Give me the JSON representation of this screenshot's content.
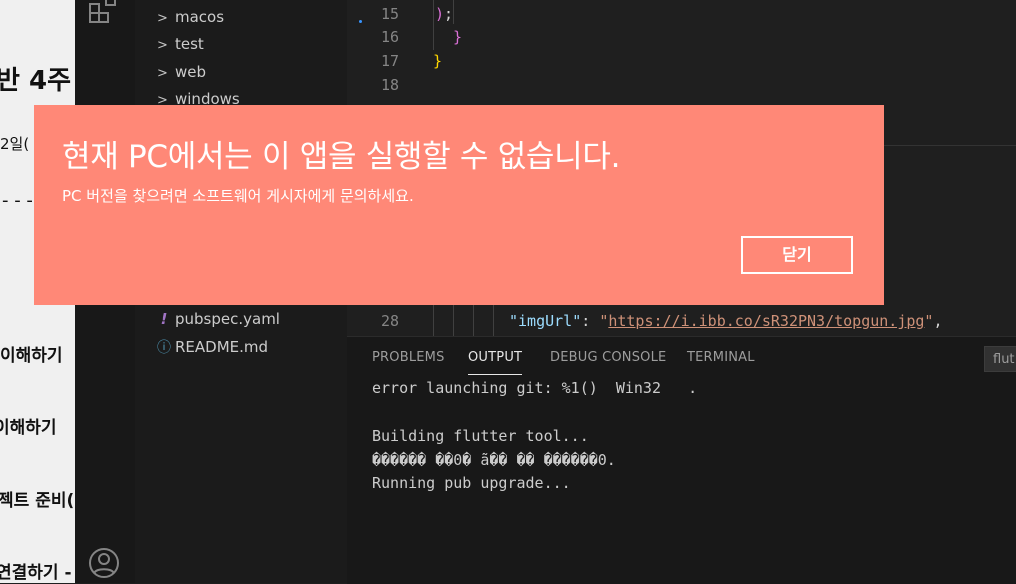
{
  "doc": {
    "heading": "반 4주",
    "date": "2일(",
    "dashes": "- - -",
    "items": [
      "이해하기",
      "이해하기",
      "젝트 준비(",
      "연결하기 -"
    ]
  },
  "explorer": {
    "folders": [
      "macos",
      "test",
      "web",
      "windows"
    ],
    "files": [
      {
        "name": "pubspec.yaml",
        "icon": "!"
      },
      {
        "name": "README.md",
        "icon": "ⓘ"
      }
    ]
  },
  "editor": {
    "lines": [
      {
        "num": "15",
        "code": "  );"
      },
      {
        "num": "16",
        "code": " }"
      },
      {
        "num": "17",
        "code": "}"
      },
      {
        "num": "18",
        "code": ""
      }
    ],
    "line28": {
      "num": "28",
      "key": "\"imgUrl\"",
      "colon": ": ",
      "q1": "\"",
      "url": "https://i.ibb.co/sR32PN3/topgun.jpg",
      "q2": "\"",
      "comma": ","
    }
  },
  "panel": {
    "tabs": [
      "PROBLEMS",
      "OUTPUT",
      "DEBUG CONSOLE",
      "TERMINAL"
    ],
    "filter_value": "flut",
    "output": [
      "error launching git: %1()  Win32   .",
      "",
      "Building flutter tool...",
      "������ ��0� ã�� �� ������0.",
      "Running pub upgrade..."
    ]
  },
  "dialog": {
    "title": "현재 PC에서는 이 앱을 실행할 수 없습니다.",
    "message": "PC 버전을 찾으려면 소프트웨어 게시자에게 문의하세요.",
    "close_label": "닫기"
  },
  "colors": {
    "dialog_bg": "#ff8877",
    "editor_bg": "#1f1f1f",
    "panel_bg": "#181818"
  }
}
